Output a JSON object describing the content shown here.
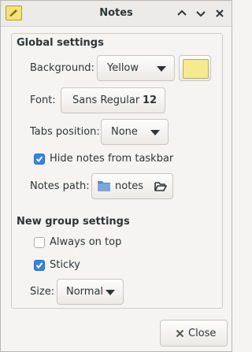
{
  "window": {
    "title": "Notes"
  },
  "global": {
    "heading": "Global settings",
    "background_label": "Background:",
    "background_value": "Yellow",
    "background_color": "#f7e98e",
    "font_label": "Font:",
    "font_name": "Sans Regular",
    "font_size": "12",
    "tabs_label": "Tabs position:",
    "tabs_value": "None",
    "hide_taskbar_label": "Hide notes from taskbar",
    "hide_taskbar_checked": true,
    "path_label": "Notes path:",
    "path_value": "notes"
  },
  "group": {
    "heading": "New group settings",
    "always_on_top_label": "Always on top",
    "always_on_top_checked": false,
    "sticky_label": "Sticky",
    "sticky_checked": true,
    "size_label": "Size:",
    "size_value": "Normal"
  },
  "footer": {
    "close_label": "Close"
  },
  "colors": {
    "accent": "#3584e4"
  }
}
